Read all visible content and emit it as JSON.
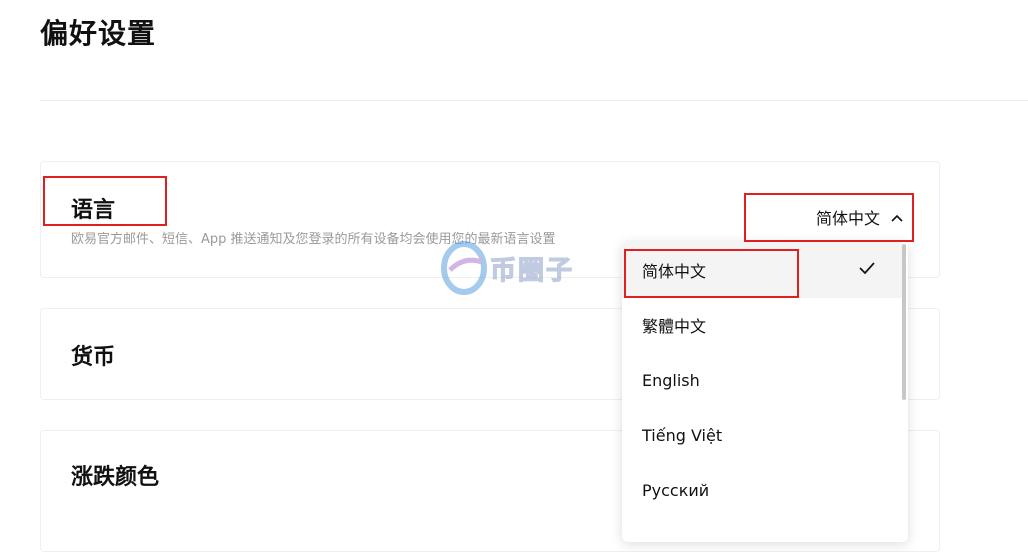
{
  "page": {
    "title": "偏好设置"
  },
  "language": {
    "title": "语言",
    "description": "欧易官方邮件、短信、App 推送通知及您登录的所有设备均会使用您的最新语言设置",
    "selected": "简体中文",
    "options": [
      "简体中文",
      "繁體中文",
      "English",
      "Tiếng Việt",
      "Русский"
    ]
  },
  "currency": {
    "title": "货币"
  },
  "color": {
    "title": "涨跌颜色"
  },
  "watermark": {
    "text": "币圈子"
  },
  "colors": {
    "annotation": "#e02020",
    "selected_bg": "#f4f4f4"
  }
}
